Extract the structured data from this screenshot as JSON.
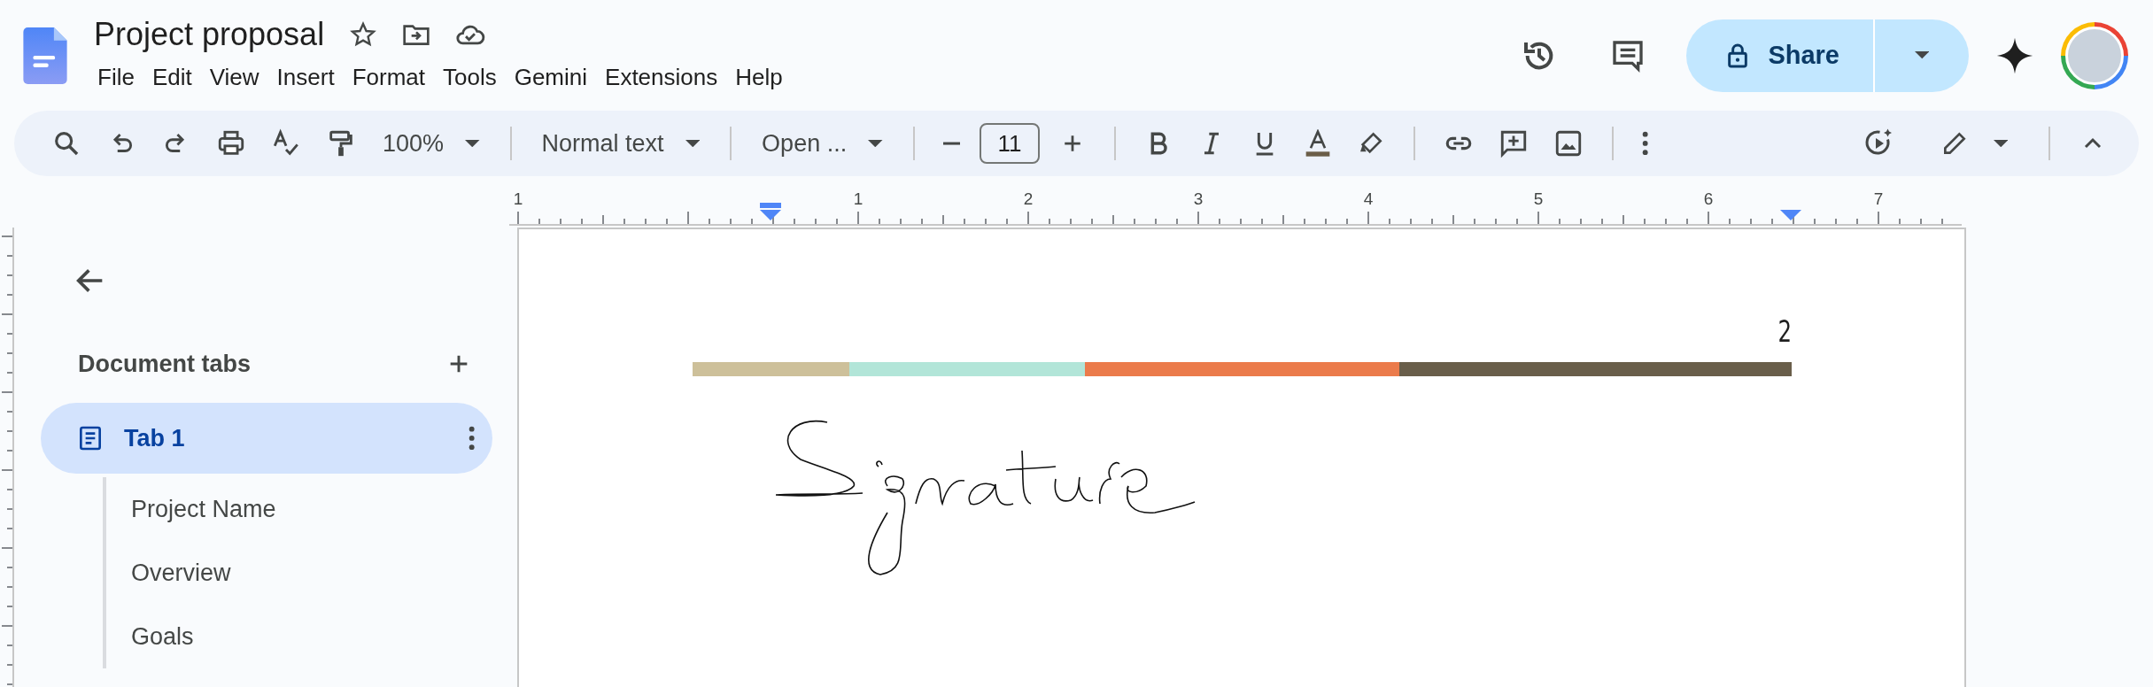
{
  "document": {
    "title": "Project proposal"
  },
  "menu": [
    "File",
    "Edit",
    "View",
    "Insert",
    "Format",
    "Tools",
    "Gemini",
    "Extensions",
    "Help"
  ],
  "share_button": {
    "label": "Share"
  },
  "toolbar": {
    "zoom": "100%",
    "paragraph_style": "Normal text",
    "font": "Open ...",
    "font_size": "11"
  },
  "ruler": {
    "labels": [
      "1",
      "1",
      "2",
      "3",
      "4",
      "5",
      "6",
      "7"
    ]
  },
  "sidebar": {
    "heading": "Document tabs",
    "tabs": [
      {
        "label": "Tab 1",
        "selected": true
      }
    ],
    "outline": [
      "Project Name",
      "Overview",
      "Goals"
    ]
  },
  "page": {
    "page_number": "2",
    "color_bar": [
      {
        "color": "#cdc09a"
      },
      {
        "color": "#b2e5d8"
      },
      {
        "color": "#eb7b4b"
      },
      {
        "color": "#695e4a"
      }
    ]
  }
}
